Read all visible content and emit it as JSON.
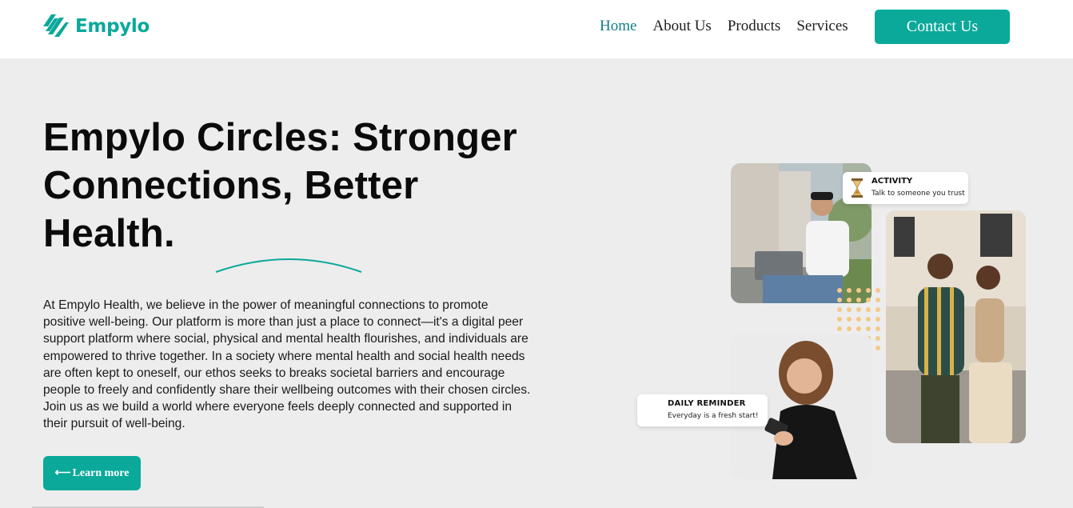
{
  "brand": {
    "name": "Empylo",
    "logo_icon": "stripes-logo-icon",
    "accent_color": "#0aa99a"
  },
  "nav": {
    "items": [
      {
        "label": "Home",
        "active": true
      },
      {
        "label": "About Us",
        "active": false
      },
      {
        "label": "Products",
        "active": false
      },
      {
        "label": "Services",
        "active": false
      }
    ],
    "contact_label": "Contact Us"
  },
  "hero": {
    "title": "Empylo Circles: Stronger Connections, Better Health.",
    "body": "At Empylo Health, we believe in the power of meaningful connections to promote positive well-being. Our platform is more than just a place to connect—it's a digital peer support platform where social, physical and mental health flourishes, and individuals are empowered to thrive together. In a society where mental health and social health needs are often kept to oneself, our ethos seeks to breaks societal barriers and encourage people to freely and confidently share their wellbeing outcomes with their chosen circles. Join us as we build a world where everyone feels deeply connected and supported in their pursuit of well-being.",
    "cta_arrow": "⟵",
    "cta_label": "Learn more"
  },
  "cards": {
    "activity": {
      "title": "ACTIVITY",
      "subtitle": "Talk to someone you trust",
      "icon": "hourglass-icon"
    },
    "reminder": {
      "title": "DAILY REMINDER",
      "subtitle": "Everyday is a fresh start!"
    }
  }
}
